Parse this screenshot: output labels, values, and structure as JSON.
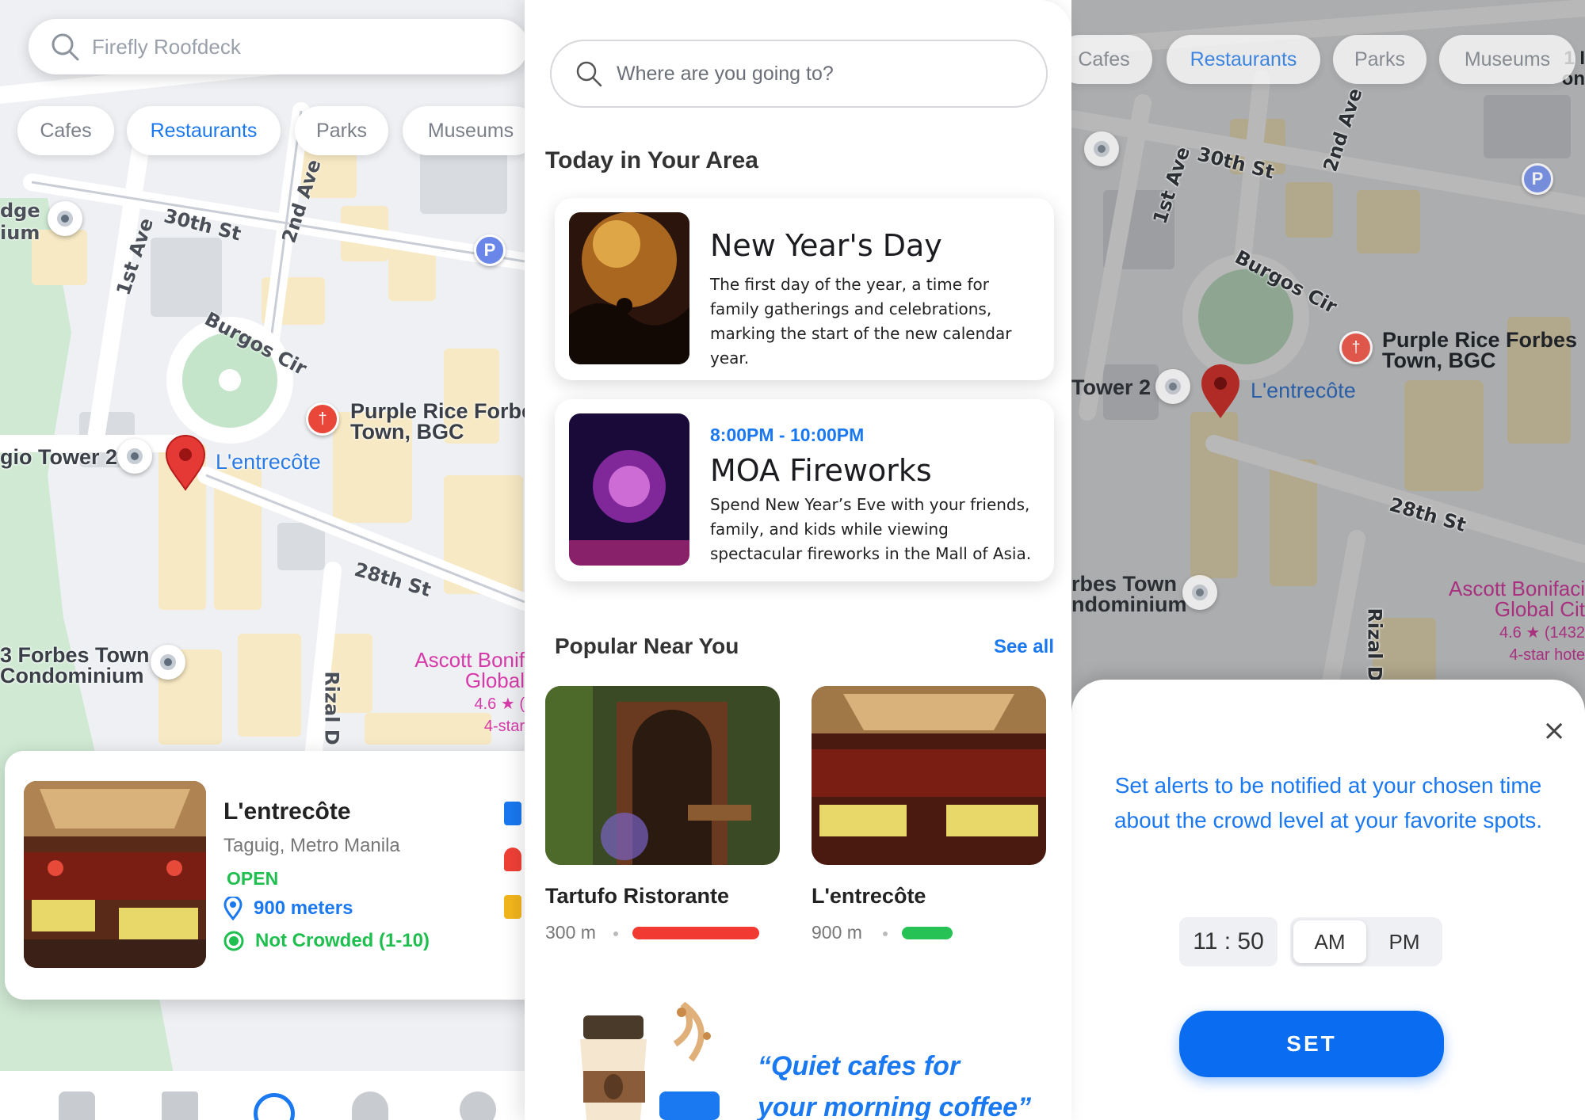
{
  "left_screen": {
    "search_value": "Firefly Roofdeck",
    "chips": [
      "Cafes",
      "Restaurants",
      "Parks",
      "Museums"
    ],
    "active_chip": "Restaurants",
    "map_labels": {
      "street_30th": "30th St",
      "street_2nd": "2nd Ave",
      "street_1st": "1st Ave",
      "street_28th": "28th St",
      "burgos": "Burgos Cir",
      "rizal": "Rizal D",
      "lodge": "dge",
      "ium": "ium",
      "tower": "gio Tower 2",
      "forbes_1": "3 Forbes Town",
      "forbes_2": "Condominium",
      "purple_1": "Purple Rice Forbes",
      "purple_2": "Town, BGC",
      "entrecote": "L'entrecôte",
      "ascott_1": "Ascott Bonif",
      "ascott_2": "Global",
      "ascott_3": "4.6 ★ (",
      "ascott_4": "4-star",
      "bottom_street": "28th St",
      "parking": "P"
    },
    "place_card": {
      "name": "L'entrecôte",
      "location": "Taguig, Metro Manila",
      "status": "OPEN",
      "distance": "900 meters",
      "crowd": "Not Crowded (1-10)"
    },
    "nav_items": [
      "home-icon",
      "map-icon",
      "globe-icon",
      "bell-icon",
      "gear-icon"
    ],
    "colors": {
      "accent": "#1a78f0",
      "open": "#1fbf4f",
      "pin": "#e53935"
    }
  },
  "middle_screen": {
    "search_placeholder": "Where are you going to?",
    "today_title": "Today in Your Area",
    "events": [
      {
        "title": "New Year's Day",
        "description": "The first day of the year, a time for family gatherings and celebrations, marking the start of the new calendar year."
      },
      {
        "time": "8:00PM - 10:00PM",
        "title": "MOA Fireworks",
        "description": "Spend New Year’s Eve with your friends, family, and kids while viewing spectacular fireworks in the Mall of Asia."
      }
    ],
    "popular_title": "Popular Near You",
    "see_all": "See all",
    "popular": [
      {
        "name": "Tartufo Ristorante",
        "distance": "300 m",
        "crowd_color": "#f03a32",
        "crowd_level": 0.9
      },
      {
        "name": "L'entrecôte",
        "distance": "900 m",
        "crowd_color": "#27c255",
        "crowd_level": 0.35
      }
    ],
    "quote_line1": "“Quiet cafes for",
    "quote_line2": "your morning coffee”"
  },
  "right_screen": {
    "chips": [
      "Cafes",
      "Restaurants",
      "Parks",
      "Museums"
    ],
    "active_chip": "Restaurants",
    "map_labels": {
      "street_30th": "30th St",
      "street_2nd": "2nd Ave",
      "street_1st": "1st Ave",
      "street_28th": "28th St",
      "burgos": "Burgos Cir",
      "rizal": "Rizal D",
      "tower": "Tower 2",
      "forbes_1": "rbes Town",
      "forbes_2": "ndominium",
      "purple_1": "Purple Rice Forbes",
      "purple_2": "Town, BGC",
      "entrecote": "L'entrecôte",
      "ascott_1": "Ascott Bonifaci",
      "ascott_2": "Global Cit",
      "ascott_3": "4.6 ★ (1432",
      "ascott_4": "4-star hote",
      "edge_1": "1 I",
      "edge_2": "on",
      "parking": "P"
    },
    "sheet": {
      "message": "Set alerts to be notified at your chosen time about the crowd level at your favorite spots.",
      "time": "11 : 50",
      "am": "AM",
      "pm": "PM",
      "set_label": "SET"
    }
  }
}
